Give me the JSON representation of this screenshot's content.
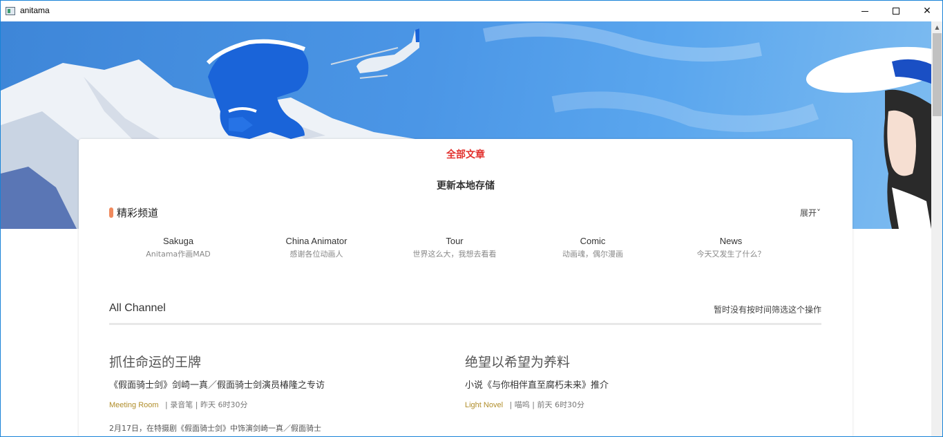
{
  "window": {
    "title": "anitama",
    "minimize": "",
    "maximize": "",
    "close": "✕"
  },
  "header": {
    "all_articles": "全部文章",
    "update_storage": "更新本地存储"
  },
  "featured": {
    "title": "精彩频道",
    "expand": "展开˅",
    "channels": [
      {
        "name": "Sakuga",
        "desc": "Anitama作画MAD"
      },
      {
        "name": "China Animator",
        "desc": "感谢各位动画人"
      },
      {
        "name": "Tour",
        "desc": "世界这么大，我想去看看"
      },
      {
        "name": "Comic",
        "desc": "动画魂，偶尔漫画"
      },
      {
        "name": "News",
        "desc": "今天又发生了什么？"
      }
    ]
  },
  "all_channel": {
    "title": "All Channel",
    "filter_note": "暂时没有按时间筛选这个操作"
  },
  "articles": [
    {
      "title": "抓住命运的王牌",
      "subtitle": "《假面骑士剑》剑崎一真／假面骑士剑演员椿隆之专访",
      "category": "Meeting Room",
      "meta": "|  录音笔 | 昨天 6时30分",
      "excerpt": "2月17日，在特摄剧《假面骑士剑》中饰演剑崎一真／假面骑士"
    },
    {
      "title": "绝望以希望为养料",
      "subtitle": "小说《与你相伴直至腐朽未来》推介",
      "category": "Light Novel",
      "meta": "|  喵呜 | 前天 6时30分",
      "excerpt": ""
    }
  ],
  "colors": {
    "accent_red": "#e2312e",
    "category_gold": "#b08d2a",
    "section_bar": "#f08a5d",
    "window_border": "#1883d7"
  },
  "icons": {
    "app": "app-window-icon",
    "minimize": "minimize-icon",
    "maximize": "maximize-icon",
    "close": "close-icon",
    "scroll_up": "scroll-up-arrow-icon"
  }
}
